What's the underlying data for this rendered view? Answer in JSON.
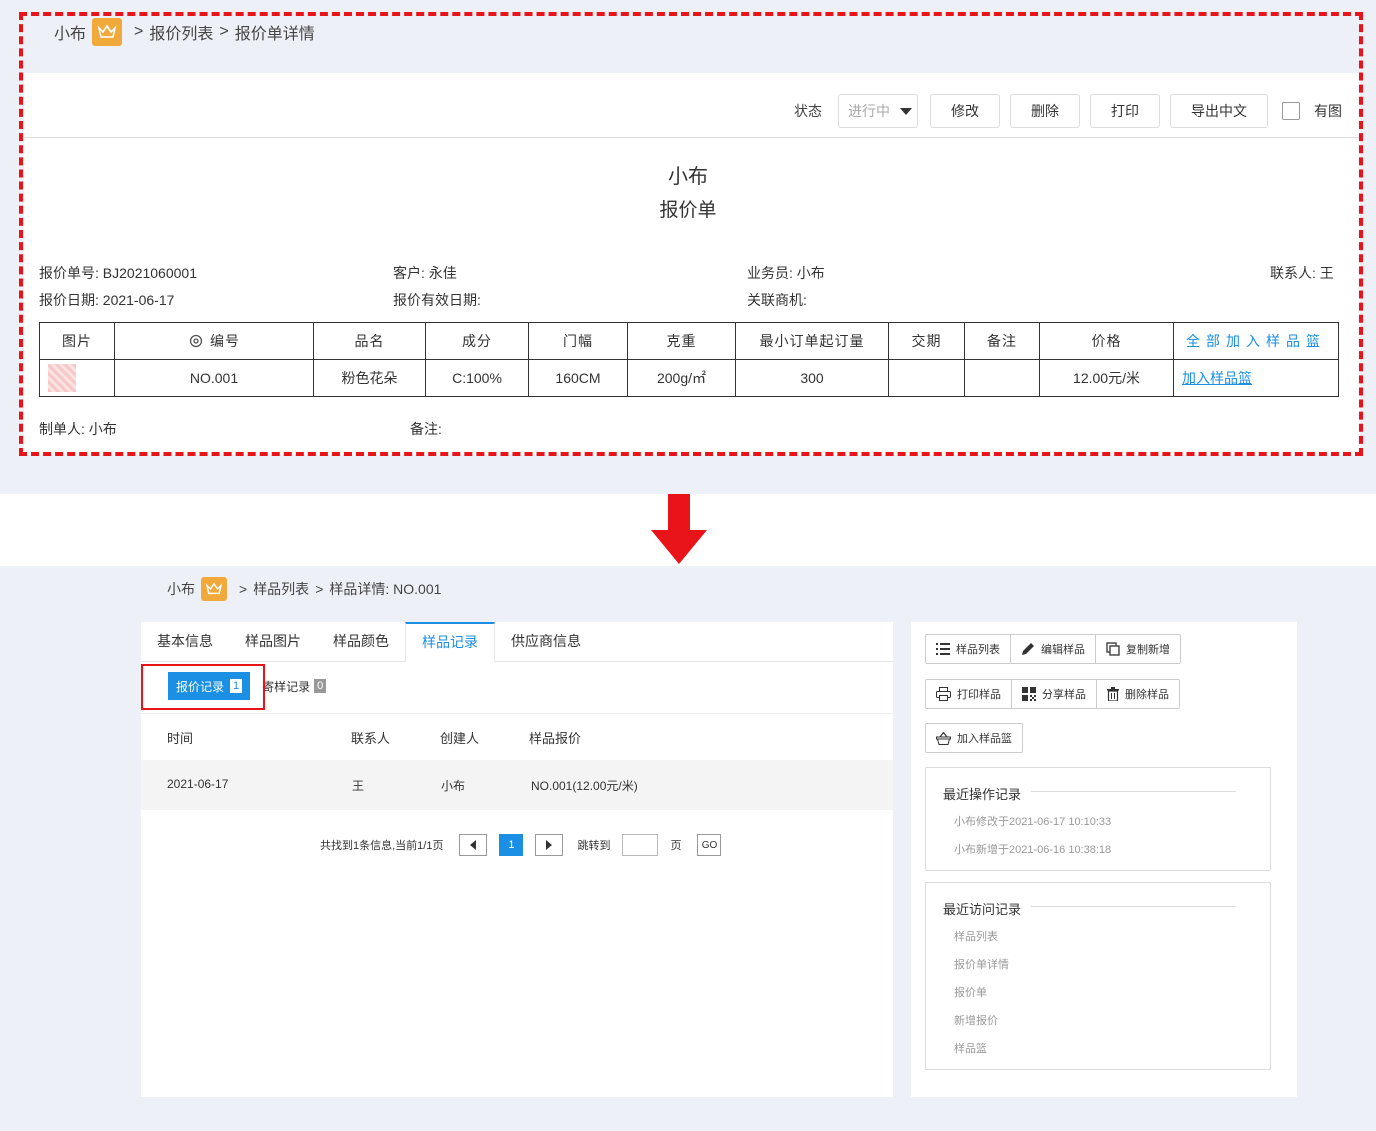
{
  "top": {
    "breadcrumb": {
      "home": "小布",
      "sep1": ">",
      "list": "报价列表",
      "sep2": ">",
      "current": "报价单详情"
    },
    "toolbar": {
      "status_label": "状态",
      "status_value": "进行中",
      "edit": "修改",
      "delete": "删除",
      "print": "打印",
      "export": "导出中文",
      "with_image": "有图"
    },
    "doc_company": "小布",
    "doc_type": "报价单",
    "info": {
      "quote_no_label": "报价单号:",
      "quote_no": "BJ2021060001",
      "customer_label": "客户:",
      "customer": "永佳",
      "sales_label": "业务员:",
      "sales": "小布",
      "contact_label": "联系人:",
      "contact": "王",
      "date_label": "报价日期:",
      "date": "2021-06-17",
      "valid_label": "报价有效日期:",
      "opportunity_label": "关联商机:"
    },
    "table": {
      "headers": [
        "图片",
        "编号",
        "品名",
        "成分",
        "门幅",
        "克重",
        "最小订单起订量",
        "交期",
        "备注",
        "价格",
        "全部加入样品篮"
      ],
      "row": {
        "no": "NO.001",
        "name": "粉色花朵",
        "composition": "C:100%",
        "width": "160CM",
        "weight": "200g/㎡",
        "moq": "300",
        "delivery": "",
        "remark": "",
        "price": "12.00元/米",
        "action": "加入样品篮"
      }
    },
    "footer": {
      "maker_label": "制单人:",
      "maker": "小布",
      "remark_label": "备注:"
    }
  },
  "bottom": {
    "breadcrumb": {
      "home": "小布",
      "sep1": ">",
      "list": "样品列表",
      "sep2": ">",
      "current": "样品详情: NO.001"
    },
    "tabs": [
      "基本信息",
      "样品图片",
      "样品颜色",
      "样品记录",
      "供应商信息"
    ],
    "sub_tabs": {
      "quote_label": "报价记录",
      "quote_count": "1",
      "send_label": "寄样记录",
      "send_count": "0"
    },
    "record_headers": [
      "时间",
      "联系人",
      "创建人",
      "样品报价"
    ],
    "record_row": {
      "time": "2021-06-17",
      "contact": "王",
      "creator": "小布",
      "quote": "NO.001(12.00元/米)"
    },
    "pager": {
      "summary": "共找到1条信息,当前1/1页",
      "current": "1",
      "jump_label": "跳转到",
      "page_label": "页",
      "go": "GO"
    },
    "actions": {
      "list": "样品列表",
      "edit": "编辑样品",
      "copy": "复制新增",
      "print": "打印样品",
      "share": "分享样品",
      "delete": "删除样品",
      "basket": "加入样品篮"
    },
    "ops": {
      "title": "最近操作记录",
      "items": [
        "小布修改于2021-06-17 10:10:33",
        "小布新增于2021-06-16 10:38:18"
      ]
    },
    "visits": {
      "title": "最近访问记录",
      "items": [
        "样品列表",
        "报价单详情",
        "报价单",
        "新增报价",
        "样品篮"
      ]
    }
  }
}
